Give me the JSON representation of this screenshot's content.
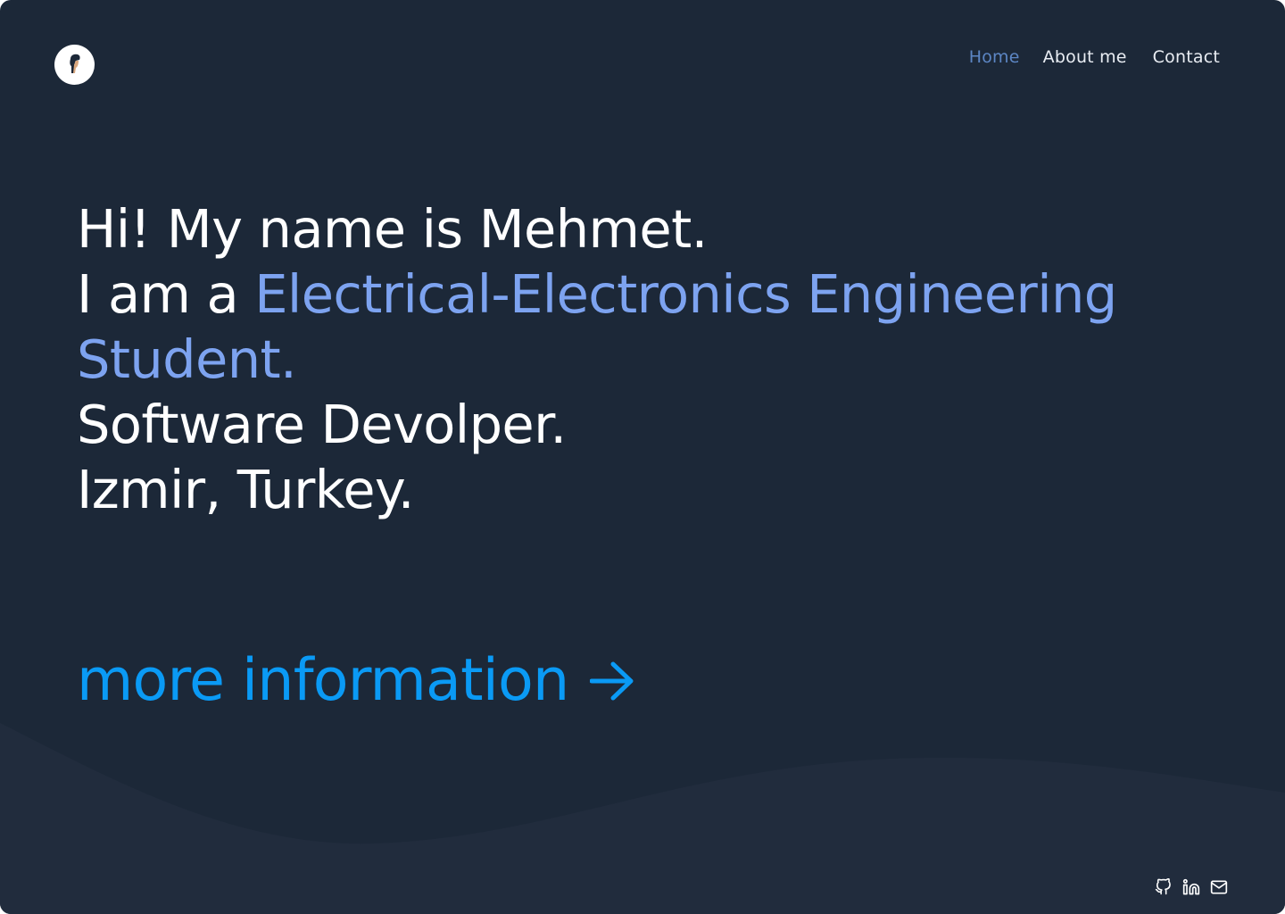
{
  "colors": {
    "background": "#1c2838",
    "wave": "#212c3d",
    "nav_active": "#5c86c4",
    "accent_text": "#7da3f0",
    "cta": "#0a9af5"
  },
  "header": {
    "logo_icon": "avatar-icon",
    "nav": {
      "home": "Home",
      "about": "About me",
      "contact": "Contact"
    }
  },
  "hero": {
    "greeting": "Hi! My name is Mehmet.",
    "role_prefix": "I am a ",
    "role_accent_1": "Electrical-Electronics Engineering",
    "role_accent_2": "Student.",
    "line_software": "Software Devolper.",
    "line_location": "Izmir, Turkey."
  },
  "cta": {
    "label": "more information",
    "icon": "arrow-right-icon"
  },
  "social": {
    "icons": [
      "github-icon",
      "linkedin-icon",
      "mail-icon"
    ]
  }
}
